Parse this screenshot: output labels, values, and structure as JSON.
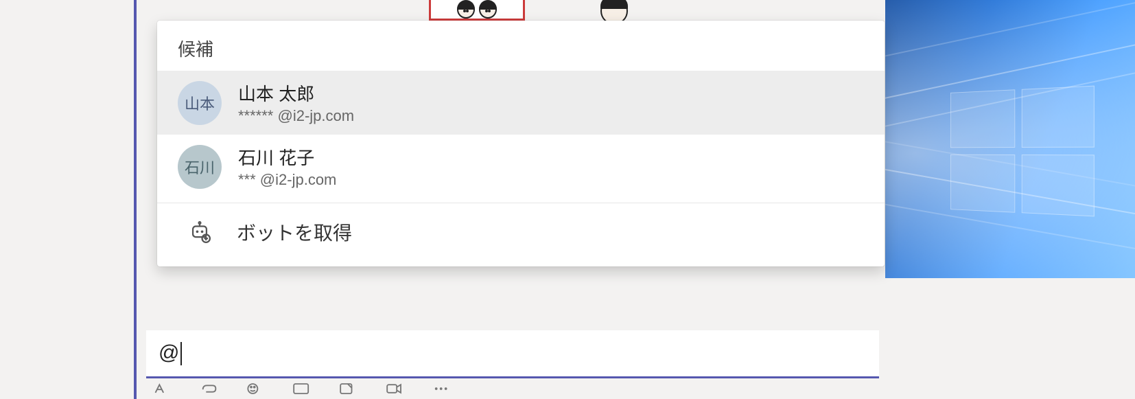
{
  "popup": {
    "header": "候補",
    "suggestions": [
      {
        "avatar_initials": "山本",
        "name": "山本 太郎",
        "email": "****** @i2-jp.com",
        "selected": true
      },
      {
        "avatar_initials": "石川",
        "name": "石川 花子",
        "email": "*** @i2-jp.com",
        "selected": false
      }
    ],
    "bot_action": "ボットを取得"
  },
  "compose": {
    "text": "@"
  }
}
